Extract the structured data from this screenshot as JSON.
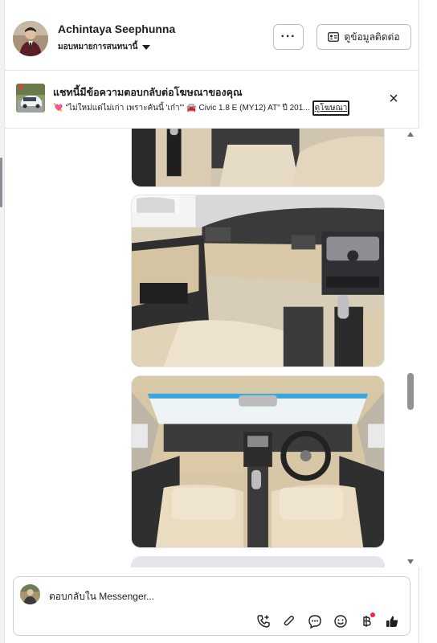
{
  "header": {
    "contact_name": "Achintaya Seephunna",
    "assign_label": "มอบหมายการสนทนานี้",
    "more_label": "···",
    "contact_info_label": "ดูข้อมูลติดต่อ"
  },
  "banner": {
    "title": "แชทนี้มีข้อความตอบกลับต่อโฆษณาของคุณ",
    "emoji_heart": "💘",
    "ad_text": "\"ไม่ใหม่แต่ไม่เก่า เพราะคันนี้ 'เก๋า'\"",
    "emoji_car": "🚘",
    "ad_model": "Civic 1.8 E (MY12) AT\" ปี 201...",
    "link_label": "ดูโฆษณา",
    "close_label": "×"
  },
  "thread": {
    "images": [
      "car-interior-console",
      "car-dashboard-passenger-side",
      "car-cabin-front-view",
      "car-photo-loading"
    ]
  },
  "composer": {
    "placeholder": "ตอบกลับใน Messenger...",
    "tools": [
      "phone-add-icon",
      "attach-icon",
      "reply-bubble-icon",
      "emoji-icon",
      "baht-icon",
      "thumbs-up-icon"
    ]
  },
  "colors": {
    "accent": "#1c1e21",
    "border": "#e4e6eb",
    "notification_dot": "#f02849"
  }
}
